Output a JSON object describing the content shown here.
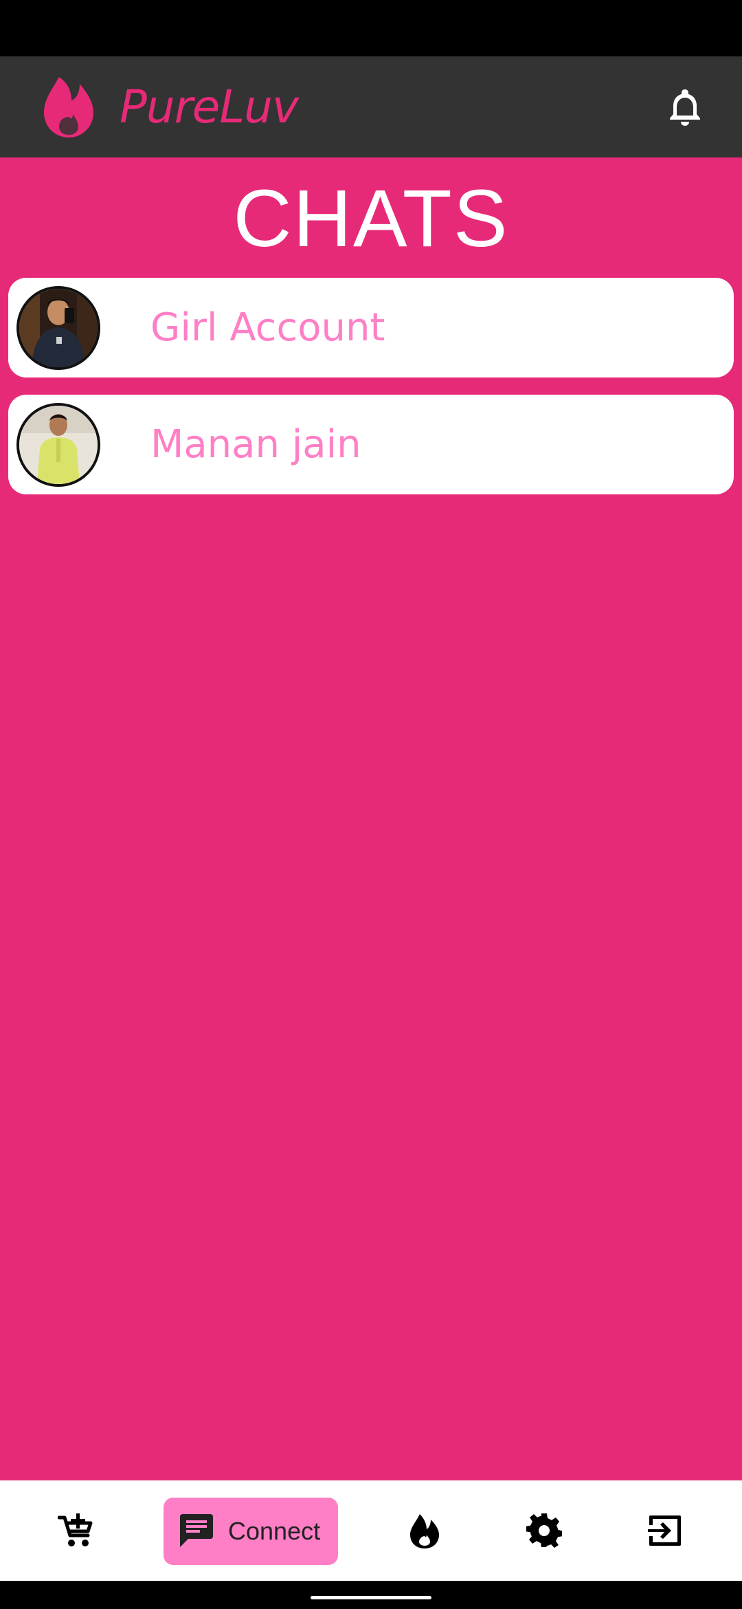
{
  "app": {
    "brand_name": "PureLuv",
    "colors": {
      "accent": "#E72A78",
      "header_bg": "#333333",
      "chat_name": "#FF7FC6",
      "nav_active": "#FF7FC6"
    }
  },
  "header": {
    "logo_icon": "flame-icon",
    "notification_icon": "bell-icon"
  },
  "page": {
    "title": "CHATS"
  },
  "chats": [
    {
      "name": "Girl Account",
      "avatar": "user-photo"
    },
    {
      "name": "Manan jain",
      "avatar": "user-photo"
    }
  ],
  "bottom_nav": {
    "items": [
      {
        "icon": "add-to-cart-icon",
        "label": ""
      },
      {
        "icon": "chat-icon",
        "label": "Connect",
        "active": true
      },
      {
        "icon": "flame-icon",
        "label": ""
      },
      {
        "icon": "gear-icon",
        "label": ""
      },
      {
        "icon": "logout-icon",
        "label": ""
      }
    ]
  }
}
